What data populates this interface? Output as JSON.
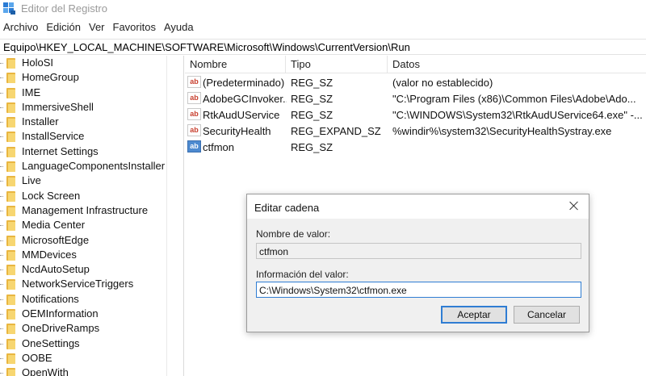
{
  "window": {
    "title": "Editor del Registro"
  },
  "menu": [
    "Archivo",
    "Edición",
    "Ver",
    "Favoritos",
    "Ayuda"
  ],
  "address": "Equipo\\HKEY_LOCAL_MACHINE\\SOFTWARE\\Microsoft\\Windows\\CurrentVersion\\Run",
  "tree": [
    "HoloSI",
    "HomeGroup",
    "IME",
    "ImmersiveShell",
    "Installer",
    "InstallService",
    "Internet Settings",
    "LanguageComponentsInstaller",
    "Live",
    "Lock Screen",
    "Management Infrastructure",
    "Media Center",
    "MicrosoftEdge",
    "MMDevices",
    "NcdAutoSetup",
    "NetworkServiceTriggers",
    "Notifications",
    "OEMInformation",
    "OneDriveRamps",
    "OneSettings",
    "OOBE",
    "OpenWith"
  ],
  "list": {
    "headers": {
      "name": "Nombre",
      "type": "Tipo",
      "data": "Datos"
    },
    "rows": [
      {
        "name": "(Predeterminado)",
        "type": "REG_SZ",
        "data": "(valor no establecido)",
        "icon": "string-value-icon"
      },
      {
        "name": "AdobeGCInvoker...",
        "type": "REG_SZ",
        "data": "\"C:\\Program Files (x86)\\Common Files\\Adobe\\Ado...",
        "icon": "string-value-icon"
      },
      {
        "name": "RtkAudUService",
        "type": "REG_SZ",
        "data": "\"C:\\WINDOWS\\System32\\RtkAudUService64.exe\" -...",
        "icon": "string-value-icon"
      },
      {
        "name": "SecurityHealth",
        "type": "REG_EXPAND_SZ",
        "data": "%windir%\\system32\\SecurityHealthSystray.exe",
        "icon": "string-value-icon"
      },
      {
        "name": "ctfmon",
        "type": "REG_SZ",
        "data": "",
        "icon": "selected-value-icon"
      }
    ],
    "icon_glyph": "ab"
  },
  "dialog": {
    "title": "Editar cadena",
    "name_label": "Nombre de valor:",
    "name_value": "ctfmon",
    "data_label": "Información del valor:",
    "data_value": "C:\\Windows\\System32\\ctfmon.exe",
    "ok_label": "Aceptar",
    "cancel_label": "Cancelar"
  },
  "colors": {
    "accent": "#2f7dd3",
    "folder": "#f7d671",
    "dialog_bg": "#f0f0f0"
  }
}
